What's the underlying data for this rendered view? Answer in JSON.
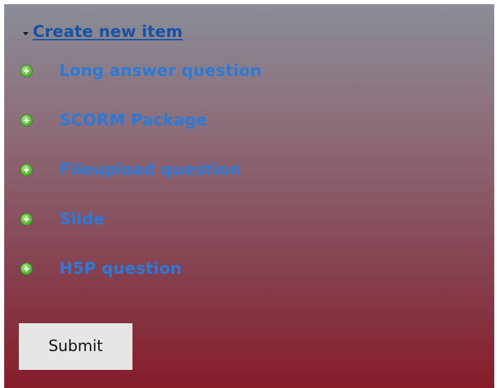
{
  "section": {
    "title": "Create new item"
  },
  "items": [
    {
      "label": "Long answer question",
      "icon": "plus-circle-icon"
    },
    {
      "label": "SCORM Package",
      "icon": "plus-circle-icon"
    },
    {
      "label": "Fileupload question",
      "icon": "plus-circle-icon"
    },
    {
      "label": "Slide",
      "icon": "plus-circle-icon"
    },
    {
      "label": "H5P question",
      "icon": "plus-circle-icon"
    }
  ],
  "actions": {
    "submit_label": "Submit"
  },
  "colors": {
    "link": "#1652a6",
    "item_label": "#2c7ad8",
    "icon_green": "#5dbd3a",
    "button_bg": "#e6e6e6"
  }
}
